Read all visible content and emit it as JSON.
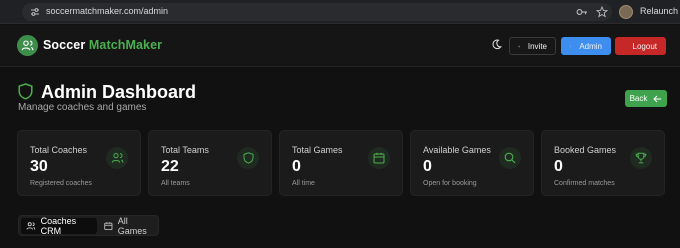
{
  "browser": {
    "url": "soccermatchmaker.com/admin",
    "relaunch_label": "Relaunch to"
  },
  "header": {
    "brand_part1": "Soccer",
    "brand_part2": "MatchMaker",
    "invite_label": "Invite",
    "admin_label": "Admin",
    "logout_label": "Logout"
  },
  "main": {
    "title": "Admin Dashboard",
    "subtitle": "Manage coaches and games",
    "back_label": "Back"
  },
  "stats": [
    {
      "label": "Total Coaches",
      "value": "30",
      "sub": "Registered coaches",
      "icon": "users-icon"
    },
    {
      "label": "Total Teams",
      "value": "22",
      "sub": "All teams",
      "icon": "shield-icon"
    },
    {
      "label": "Total Games",
      "value": "0",
      "sub": "All time",
      "icon": "calendar-icon"
    },
    {
      "label": "Available Games",
      "value": "0",
      "sub": "Open for booking",
      "icon": "search-icon"
    },
    {
      "label": "Booked Games",
      "value": "0",
      "sub": "Confirmed matches",
      "icon": "trophy-icon"
    }
  ],
  "tabs": [
    {
      "label": "Coaches CRM",
      "active": true
    },
    {
      "label": "All Games",
      "active": false
    }
  ],
  "colors": {
    "accent_green": "#4caf50",
    "admin_blue": "#3e8ef0",
    "logout_red": "#c62828",
    "background": "#111111"
  }
}
